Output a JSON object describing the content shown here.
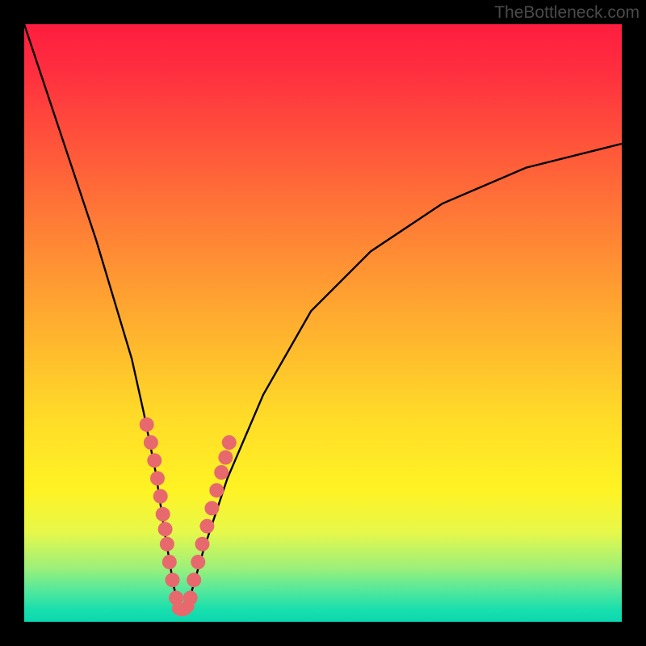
{
  "watermark": "TheBottleneck.com",
  "chart_data": {
    "type": "line",
    "title": "",
    "xlabel": "",
    "ylabel": "",
    "xlim": [
      0,
      100
    ],
    "ylim": [
      0,
      100
    ],
    "series": [
      {
        "name": "bottleneck-curve",
        "x": [
          0,
          4,
          8,
          12,
          15,
          18,
          20,
          22,
          23.5,
          25,
          26,
          27,
          28,
          30,
          34,
          40,
          48,
          58,
          70,
          84,
          100
        ],
        "y": [
          100,
          88,
          76,
          64,
          54,
          44,
          35,
          25,
          15,
          6,
          2,
          2,
          5,
          12,
          24,
          38,
          52,
          62,
          70,
          76,
          80
        ]
      }
    ],
    "markers_left": {
      "name": "left-cluster-dots",
      "points": [
        {
          "x": 20.5,
          "y": 33
        },
        {
          "x": 21.2,
          "y": 30
        },
        {
          "x": 21.8,
          "y": 27
        },
        {
          "x": 22.3,
          "y": 24
        },
        {
          "x": 22.8,
          "y": 21
        },
        {
          "x": 23.2,
          "y": 18
        },
        {
          "x": 23.6,
          "y": 15.5
        },
        {
          "x": 23.9,
          "y": 13
        },
        {
          "x": 24.3,
          "y": 10
        },
        {
          "x": 24.8,
          "y": 7
        },
        {
          "x": 25.4,
          "y": 4
        }
      ]
    },
    "markers_right": {
      "name": "right-cluster-dots",
      "points": [
        {
          "x": 27.8,
          "y": 4
        },
        {
          "x": 28.4,
          "y": 7
        },
        {
          "x": 29.1,
          "y": 10
        },
        {
          "x": 29.8,
          "y": 13
        },
        {
          "x": 30.6,
          "y": 16
        },
        {
          "x": 31.4,
          "y": 19
        },
        {
          "x": 32.2,
          "y": 22
        },
        {
          "x": 33.0,
          "y": 25
        },
        {
          "x": 33.7,
          "y": 27.5
        },
        {
          "x": 34.3,
          "y": 30
        }
      ]
    },
    "markers_bottom": {
      "name": "bottom-bridge-dots",
      "points": [
        {
          "x": 25.8,
          "y": 2.2
        },
        {
          "x": 26.2,
          "y": 2.0
        },
        {
          "x": 26.6,
          "y": 2.0
        },
        {
          "x": 27.0,
          "y": 2.2
        },
        {
          "x": 27.4,
          "y": 2.6
        }
      ]
    },
    "marker_color": "#e8696d",
    "curve_color": "#000000"
  }
}
